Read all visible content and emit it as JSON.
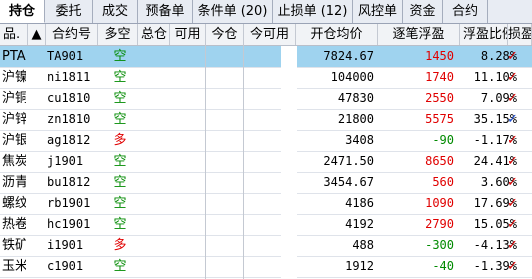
{
  "tabs": [
    "持仓",
    "委托",
    "成交",
    "预备单",
    "条件单 (20)",
    "止损单 (12)",
    "风控单",
    "资金",
    "合约"
  ],
  "headers": {
    "name": "品.",
    "sort_arrow": "▲",
    "code": "合约号",
    "dir": "多空",
    "total": "总仓",
    "avail": "可用",
    "today": "今仓",
    "today_avail": "今可用",
    "price": "开仓均价",
    "pnl": "逐笔浮盈",
    "ratio": "浮盈比例",
    "stop": "损盈"
  },
  "rows": [
    {
      "name": "PTA",
      "code": "TA901",
      "dir": "空",
      "total": "",
      "avail": "",
      "today": "",
      "today_avail": "",
      "price": "7824.67",
      "pnl": "1450",
      "ratio": "8.28%",
      "check": "✓",
      "selected": true,
      "pnl_color": "red",
      "dir_color": "green"
    },
    {
      "name": "沪镍",
      "code": "ni1811",
      "dir": "空",
      "total": "",
      "avail": "",
      "today": "",
      "today_avail": "",
      "price": "104000",
      "pnl": "1740",
      "ratio": "11.10%",
      "check": "✓",
      "selected": false,
      "pnl_color": "red",
      "dir_color": "green"
    },
    {
      "name": "沪铜",
      "code": "cu1810",
      "dir": "空",
      "total": "",
      "avail": "",
      "today": "",
      "today_avail": "",
      "price": "47830",
      "pnl": "2550",
      "ratio": "7.09%",
      "check": "✓",
      "selected": false,
      "pnl_color": "red",
      "dir_color": "green"
    },
    {
      "name": "沪锌",
      "code": "zn1810",
      "dir": "空",
      "total": "",
      "avail": "",
      "today": "",
      "today_avail": "",
      "price": "21800",
      "pnl": "5575",
      "ratio": "35.15%",
      "check": "✓",
      "selected": false,
      "pnl_color": "red",
      "dir_color": "green"
    },
    {
      "name": "沪银",
      "code": "ag1812",
      "dir": "多",
      "total": "",
      "avail": "",
      "today": "",
      "today_avail": "",
      "price": "3408",
      "pnl": "-90",
      "ratio": "-1.17%",
      "check": "✓",
      "selected": false,
      "pnl_color": "green",
      "dir_color": "red"
    },
    {
      "name": "焦炭",
      "code": "j1901",
      "dir": "空",
      "total": "",
      "avail": "",
      "today": "",
      "today_avail": "",
      "price": "2471.50",
      "pnl": "8650",
      "ratio": "24.41%",
      "check": "✓",
      "selected": false,
      "pnl_color": "red",
      "dir_color": "green"
    },
    {
      "name": "沥青",
      "code": "bu1812",
      "dir": "空",
      "total": "",
      "avail": "",
      "today": "",
      "today_avail": "",
      "price": "3454.67",
      "pnl": "560",
      "ratio": "3.60%",
      "check": "✓",
      "selected": false,
      "pnl_color": "red",
      "dir_color": "green"
    },
    {
      "name": "螺纹",
      "code": "rb1901",
      "dir": "空",
      "total": "",
      "avail": "",
      "today": "",
      "today_avail": "",
      "price": "4186",
      "pnl": "1090",
      "ratio": "17.69%",
      "check": "✓",
      "selected": false,
      "pnl_color": "red",
      "dir_color": "green"
    },
    {
      "name": "热卷",
      "code": "hc1901",
      "dir": "空",
      "total": "",
      "avail": "",
      "today": "",
      "today_avail": "",
      "price": "4192",
      "pnl": "2790",
      "ratio": "15.05%",
      "check": "✓",
      "selected": false,
      "pnl_color": "red",
      "dir_color": "green"
    },
    {
      "name": "铁矿",
      "code": "i1901",
      "dir": "多",
      "total": "",
      "avail": "",
      "today": "",
      "today_avail": "",
      "price": "488",
      "pnl": "-300",
      "ratio": "-4.13%",
      "check": "✓",
      "selected": false,
      "pnl_color": "green",
      "dir_color": "red"
    },
    {
      "name": "玉米",
      "code": "c1901",
      "dir": "空",
      "total": "",
      "avail": "",
      "today": "",
      "today_avail": "",
      "price": "1912",
      "pnl": "-40",
      "ratio": "-1.39%",
      "check": "✓",
      "selected": false,
      "pnl_color": "green",
      "dir_color": "green"
    }
  ]
}
